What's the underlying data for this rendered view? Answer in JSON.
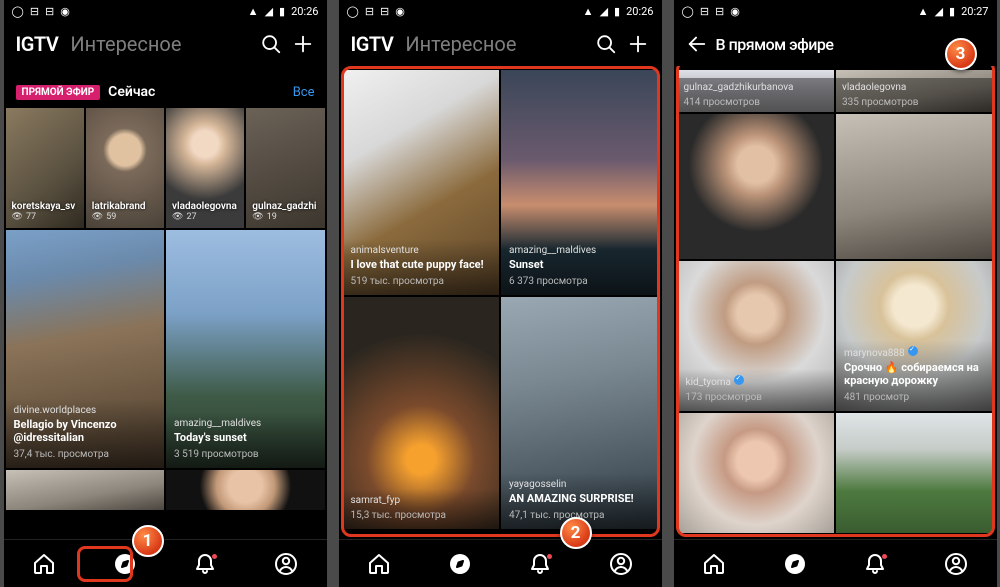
{
  "status": {
    "time1": "20:26",
    "time2": "20:26",
    "time3": "20:27"
  },
  "s1": {
    "title": "IGTV",
    "subtitle": "Интересное",
    "live": {
      "badge": "ПРЯМОЙ ЭФИР",
      "now": "Сейчас",
      "all": "Все",
      "items": [
        {
          "user": "koretskaya_sv",
          "views": "77"
        },
        {
          "user": "latrikabrand",
          "views": "59"
        },
        {
          "user": "vladaolegovna",
          "views": "27"
        },
        {
          "user": "gulnaz_gadzhi",
          "views": "19"
        }
      ]
    },
    "tiles": [
      {
        "user": "divine.worldplaces",
        "title": "Bellagio by Vincenzo @idressitalian",
        "views": "37,4 тыс. просмотра"
      },
      {
        "user": "amazing__maldives",
        "title": "Today's sunset",
        "views": "3 519 просмотров"
      }
    ],
    "badge": "1"
  },
  "s2": {
    "title": "IGTV",
    "subtitle": "Интересное",
    "tiles": [
      {
        "user": "animalsventure",
        "title": "I love that cute puppy face!",
        "views": "519 тыс. просмотра"
      },
      {
        "user": "amazing__maldives",
        "title": "Sunset",
        "views": "6 373 просмотра"
      },
      {
        "user": "samrat_fyp",
        "title": "",
        "views": "15,3 тыс. просмотра"
      },
      {
        "user": "yayagosselin",
        "title": "AN AMAZING SURPRISE!",
        "views": "47,1 тыс. просмотра"
      }
    ],
    "badge": "2"
  },
  "s3": {
    "header": "В прямом эфире",
    "tiles": [
      {
        "user": "gulnaz_gadzhikurbanova",
        "views": "414 просмотров"
      },
      {
        "user": "vladaolegovna",
        "views": "335 просмотров"
      },
      {
        "user": "kid_tyoma",
        "title": "",
        "views": "173 просмотров"
      },
      {
        "user": "marynova888",
        "title": "Срочно 🔥 собираемся на красную дорожку",
        "views": "481 просмотр"
      }
    ],
    "badge": "3"
  }
}
